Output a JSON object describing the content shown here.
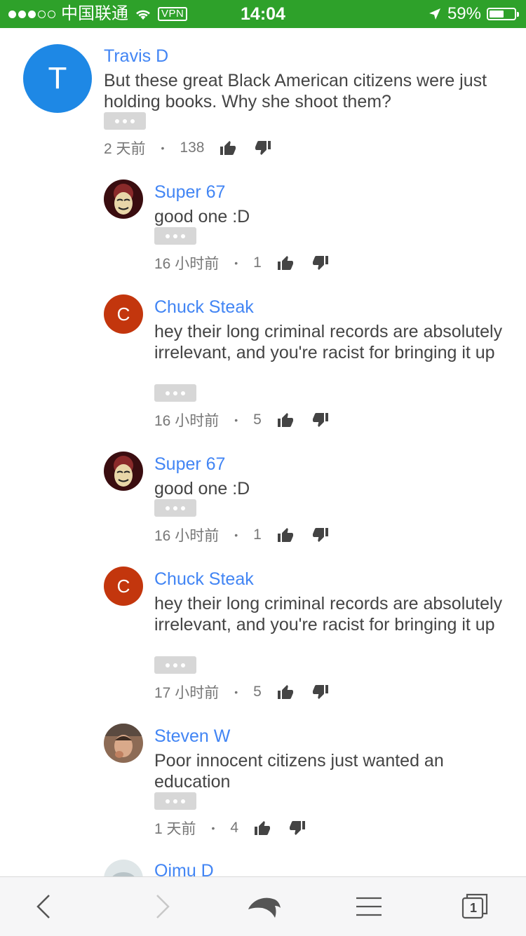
{
  "status_bar": {
    "carrier": "中国联通",
    "vpn": "VPN",
    "time": "14:04",
    "battery": "59%",
    "battery_level": 0.59,
    "background": "#2ea12a"
  },
  "comment": {
    "author": "Travis D",
    "avatar_letter": "T",
    "avatar_color": "#1e88e5",
    "text": "But these great Black American citizens were just holding books. Why she shoot them?",
    "time": "2 天前",
    "likes": "138"
  },
  "replies": [
    {
      "author": "Super 67",
      "text": "good one :D",
      "time": "16 小时前",
      "likes": "1",
      "avatar_icon": "mask-avatar-icon"
    },
    {
      "author": "Chuck Steak",
      "avatar_letter": "C",
      "avatar_color": "#c3360d",
      "text": "hey their long criminal records are absolutely irrelevant, and you're racist for bringing it up",
      "time": "16 小时前",
      "likes": "5"
    },
    {
      "author": "Super 67",
      "text": "good one :D",
      "time": "16 小时前",
      "likes": "1",
      "avatar_icon": "mask-avatar-icon"
    },
    {
      "author": "Chuck Steak",
      "avatar_letter": "C",
      "avatar_color": "#c3360d",
      "text": "hey their long criminal records are absolutely irrelevant, and you're racist for bringing it up",
      "time": "17 小时前",
      "likes": "5"
    },
    {
      "author": "Steven W",
      "text": "Poor innocent citizens just wanted an education",
      "time": "1 天前",
      "likes": "4",
      "avatar_icon": "photo-avatar-icon"
    },
    {
      "author": "Oimu D",
      "avatar_icon": "photo-avatar-icon"
    }
  ],
  "toolbar": {
    "tab_count": "1",
    "icons": [
      "back-arrow-icon",
      "forward-arrow-icon",
      "dolphin-home-icon",
      "menu-icon",
      "tabs-icon"
    ]
  }
}
